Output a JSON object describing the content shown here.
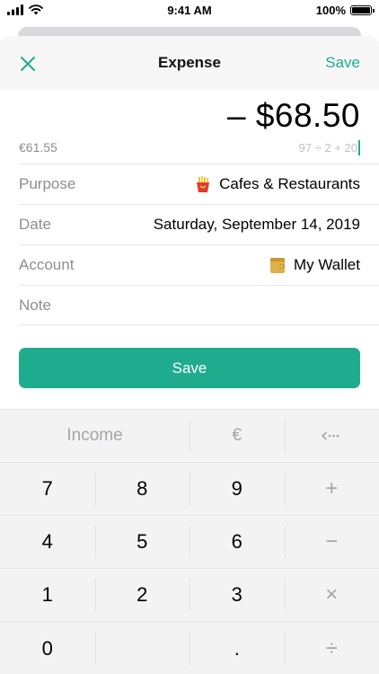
{
  "status_bar": {
    "time": "9:41 AM",
    "battery": "100%"
  },
  "nav": {
    "title": "Expense",
    "save_label": "Save"
  },
  "amount": {
    "value": "– $68.50",
    "converted": "€61.55",
    "formula": "97 ÷ 2 + 20"
  },
  "fields": {
    "purpose": {
      "label": "Purpose",
      "value": "Cafes & Restaurants",
      "icon": "fries-icon"
    },
    "date": {
      "label": "Date",
      "value": "Saturday, September 14, 2019"
    },
    "account": {
      "label": "Account",
      "value": "My Wallet",
      "icon": "wallet-icon"
    },
    "note": {
      "label": "Note",
      "value": ""
    }
  },
  "save_button": {
    "label": "Save"
  },
  "keypad": {
    "top_row": {
      "income": "Income",
      "currency": "€",
      "backspace": "⟵"
    },
    "rows": [
      [
        "7",
        "8",
        "9",
        "+"
      ],
      [
        "4",
        "5",
        "6",
        "−"
      ],
      [
        "1",
        "2",
        "3",
        "×"
      ],
      [
        "0",
        "",
        ".",
        "÷"
      ]
    ]
  },
  "colors": {
    "accent": "#1fab8e",
    "muted": "#8e8e93"
  }
}
